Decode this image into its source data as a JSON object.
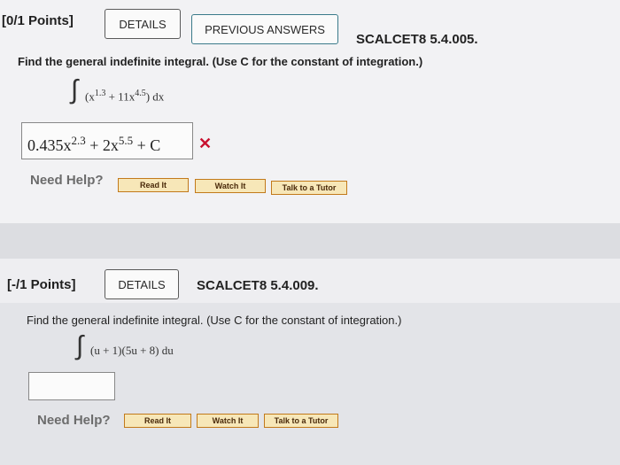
{
  "q1": {
    "points": "[0/1 Points]",
    "details_label": "DETAILS",
    "previous_answers_label": "PREVIOUS ANSWERS",
    "code": "SCALCET8 5.4.005.",
    "prompt": "Find the general indefinite integral. (Use C for the constant of integration.)",
    "integrand": {
      "a": "(x",
      "a_exp": "1.3",
      "b": " + 11x",
      "b_exp": "4.5",
      "c": ") dx"
    },
    "answer": {
      "t1": "0.435x",
      "t1_exp": "2.3",
      "t2": " + 2x",
      "t2_exp": "5.5",
      "t3": " + C"
    },
    "status_mark": "✕",
    "need_help": "Need Help?",
    "read_label": "Read It",
    "watch_label": "Watch It",
    "tutor_label": "Talk to a Tutor"
  },
  "q2": {
    "points": "[-/1 Points]",
    "details_label": "DETAILS",
    "code": "SCALCET8 5.4.009.",
    "prompt": "Find the general indefinite integral. (Use C for the constant of integration.)",
    "integrand": "(u + 1)(5u + 8) du",
    "answer_value": "",
    "need_help": "Need Help?",
    "read_label": "Read It",
    "watch_label": "Watch It",
    "tutor_label": "Talk to a Tutor"
  },
  "colors": {
    "wrong": "#c8102e",
    "help_button_border": "#c27a1b",
    "help_button_fill": "#f7e7b8"
  }
}
